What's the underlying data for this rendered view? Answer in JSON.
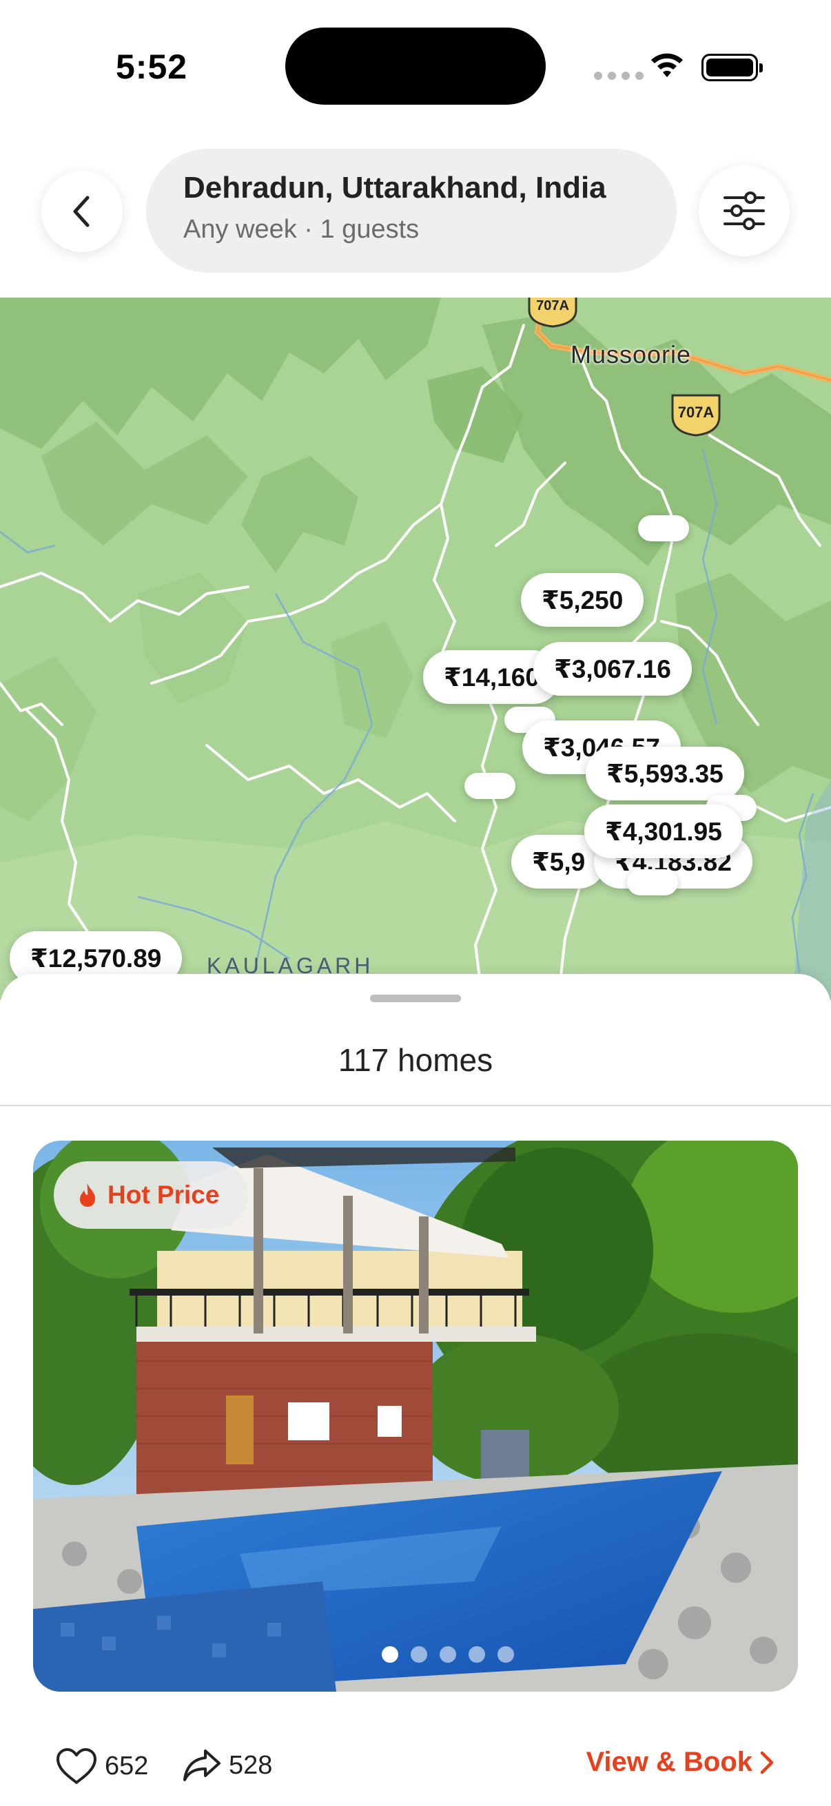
{
  "status_bar": {
    "time": "5:52"
  },
  "header": {
    "location": "Dehradun, Uttarakhand, India",
    "subtitle": "Any week · 1 guests",
    "back_icon": "chevron-left-icon",
    "filter_icon": "sliders-icon"
  },
  "map": {
    "labels": {
      "town": "Mussoorie",
      "area": "KAULAGARH",
      "road_1": "707A",
      "road_2": "707A"
    },
    "price_pins": [
      "₹5,250",
      "₹14,160",
      "₹3,067.16",
      "₹3,046.57",
      "₹5,593.35",
      "₹4,301.95",
      "₹5,9",
      "₹4,183.82",
      "₹12,570.89"
    ]
  },
  "sheet": {
    "count": "117 homes",
    "badge": "Hot Price",
    "likes": "652",
    "shares": "528",
    "cta": "View & Book",
    "colors": {
      "accent": "#e8401c"
    }
  }
}
